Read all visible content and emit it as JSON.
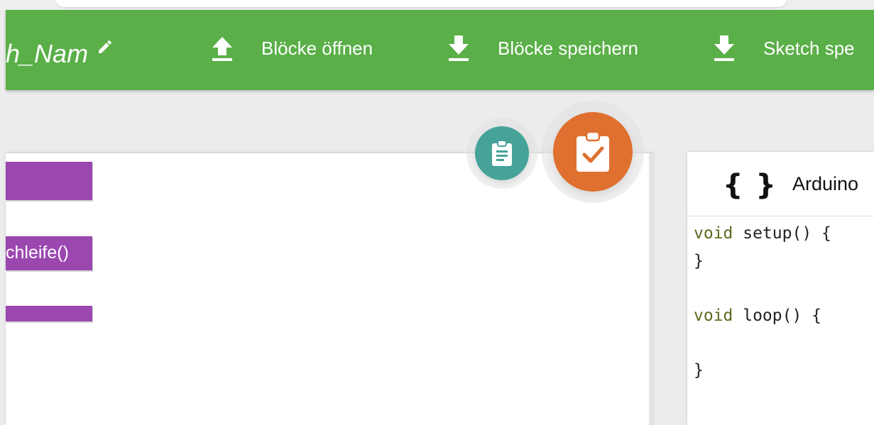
{
  "toolbar": {
    "sketch_name": "h_Nam",
    "buttons": [
      {
        "label": "Blöcke öffnen",
        "icon": "upload-icon"
      },
      {
        "label": "Blöcke speichern",
        "icon": "download-icon"
      },
      {
        "label": "Sketch spe",
        "icon": "download-icon"
      }
    ]
  },
  "workspace": {
    "blocks": [
      {
        "label": ""
      },
      {
        "label": "chleife()"
      },
      {
        "label": ""
      }
    ]
  },
  "fabs": {
    "small": {
      "icon": "clipboard-list-icon",
      "color": "#46a39a"
    },
    "large": {
      "icon": "clipboard-check-icon",
      "color": "#e07030"
    }
  },
  "code_panel": {
    "icon": "{ }",
    "title": "Arduino",
    "lines": [
      [
        "void",
        " setup() {"
      ],
      [
        "",
        "}"
      ],
      [
        "",
        ""
      ],
      [
        "void",
        " loop() {"
      ],
      [
        "",
        ""
      ],
      [
        "",
        "}"
      ]
    ]
  },
  "colors": {
    "toolbar": "#5aaf48",
    "block": "#9b47b0",
    "fab_small": "#46a39a",
    "fab_large": "#e07030",
    "keyword": "#5b6b1e"
  }
}
